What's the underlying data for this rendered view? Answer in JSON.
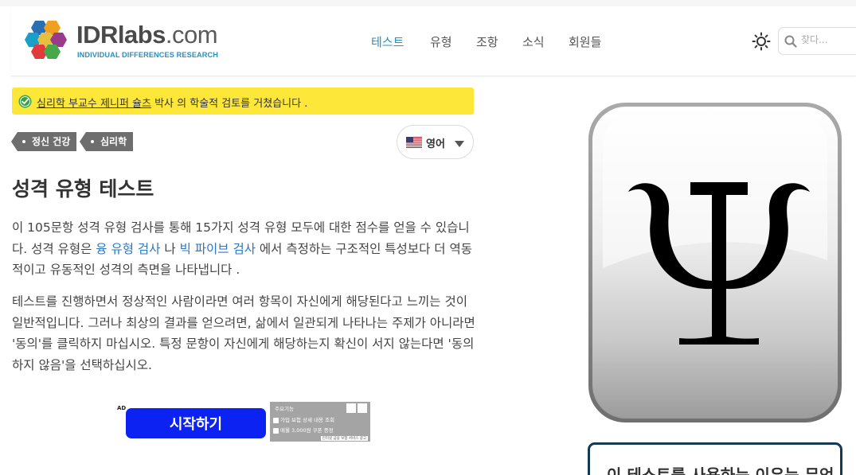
{
  "header": {
    "logo": {
      "name_strong": "IDRlabs",
      "name_light": ".com",
      "subtitle": "INDIVIDUAL DIFFERENCES RESEARCH"
    },
    "nav": [
      {
        "label": "테스트",
        "active": true
      },
      {
        "label": "유형",
        "active": false
      },
      {
        "label": "조항",
        "active": false
      },
      {
        "label": "소식",
        "active": false
      },
      {
        "label": "회원들",
        "active": false
      }
    ],
    "theme_icon": "sun-icon",
    "search": {
      "placeholder": "찾다..."
    }
  },
  "review_banner": {
    "reviewer_link": "심리학 부교수 제니퍼 슐츠",
    "rest": " 박사 의 학술적 검토를 거쳤습니다 .",
    "icon": "verified-check-icon"
  },
  "tags": [
    "정신 건강",
    "심리학"
  ],
  "language": {
    "label": "영어",
    "flag": "us-flag-icon"
  },
  "page": {
    "title": "성격 유형 테스트",
    "intro": {
      "part1": "이 105문항 성격 유형 검사를 통해 15가지 성격 유형 모두에 대한 점수를 얻을 수 있습니다. 성격 유형은 ",
      "link1": "융 유형 검사",
      "part2": " 나 ",
      "link2": "빅 파이브 검사",
      "part3": " 에서 측정하는 구조적인 특성보다 더 역동적이고 유동적인 성격의 측면을 나타냅니다 ."
    },
    "instructions": "테스트를 진행하면서 정상적인 사람이라면 여러 항목이 자신에게 해당된다고 느끼는 것이 일반적입니다. 그러나 최상의 결과를 얻으려면, 삶에서 일관되게 나타나는 주제가 아니라면 '동의'를 클릭하지 마십시오. 특정 문항이 자신에게 해당하는지 확신이 서지 않는다면 '동의하지 않음'을 선택하십시오."
  },
  "ad": {
    "label": "AD",
    "heading": "주요기능",
    "rows": [
      "가입 보험 상세 내용 조회",
      "매월 3,000원 쿠폰 증정"
    ],
    "footer": "인터넷 금융 보험 서비스 광고"
  },
  "start_button": {
    "label": "시작하기"
  },
  "side": {
    "image_icon": "psi-symbol-icon",
    "card_title": "이 테스트를 사용하는 이유는 무엇"
  },
  "colors": {
    "accent": "#2a8fc4",
    "banner": "#fde83a",
    "start_button": "#0c22f2",
    "tag": "#6e6e6e",
    "card_border": "#123a55"
  }
}
